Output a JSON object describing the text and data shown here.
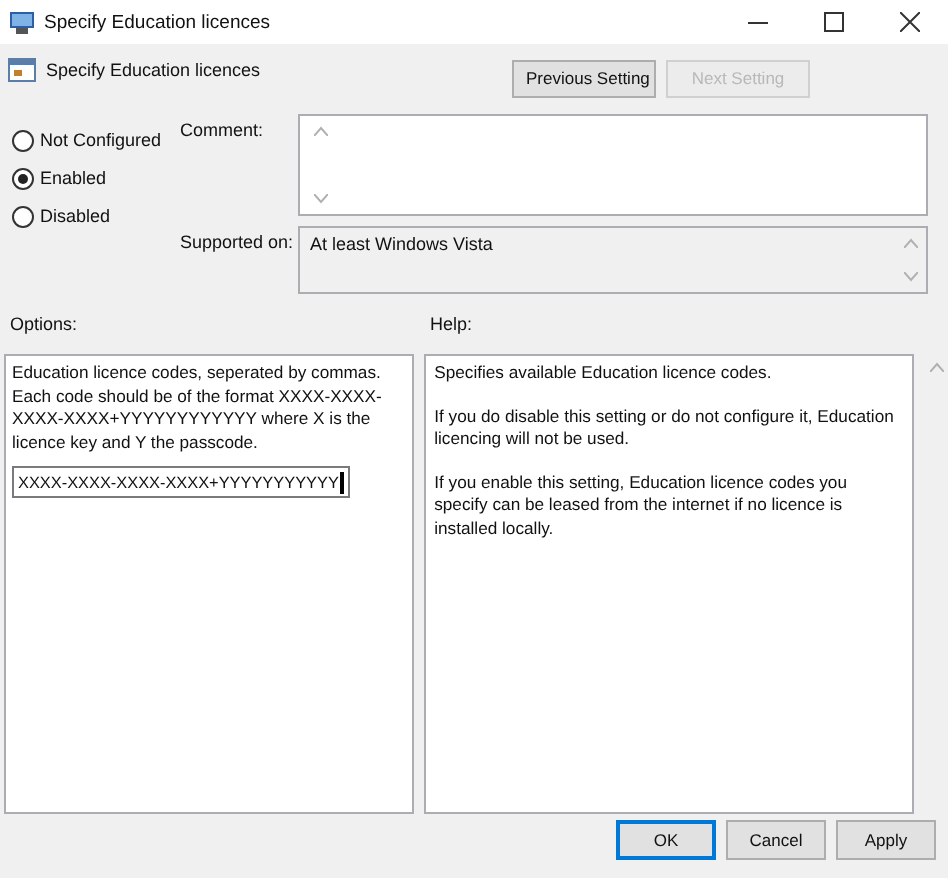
{
  "window": {
    "title": "Specify Education licences"
  },
  "header": {
    "title": "Specify Education licences",
    "buttons": [
      {
        "label": "Previous Setting",
        "disabled": false
      },
      {
        "label": "Next Setting",
        "disabled": true
      }
    ]
  },
  "state_options": [
    {
      "label": "Not Configured",
      "selected": false
    },
    {
      "label": "Enabled",
      "selected": true
    },
    {
      "label": "Disabled",
      "selected": false
    }
  ],
  "comment": {
    "label": "Comment:"
  },
  "supported_on": {
    "label": "Supported on:",
    "value": "At least Windows Vista"
  },
  "options": {
    "label": "Options:",
    "description": "Education licence codes, seperated by commas. Each code should be of the format XXXX-XXXX-XXXX-XXXX+YYYYYYYYYYYY where X is the licence key and Y the passcode.",
    "code_value": "XXXX-XXXX-XXXX-XXXX+YYYYYYYYYYY"
  },
  "help": {
    "label": "Help:",
    "paragraphs": [
      "Specifies available Education licence codes.",
      "If you do disable this setting or do not configure it, Education licencing will not be used.",
      "If you enable this setting, Education licence codes you specify can be leased from the internet if no licence is installed locally."
    ]
  },
  "footer_buttons": [
    {
      "label": "OK",
      "default": true
    },
    {
      "label": "Cancel",
      "default": false
    },
    {
      "label": "Apply",
      "default": false
    }
  ]
}
